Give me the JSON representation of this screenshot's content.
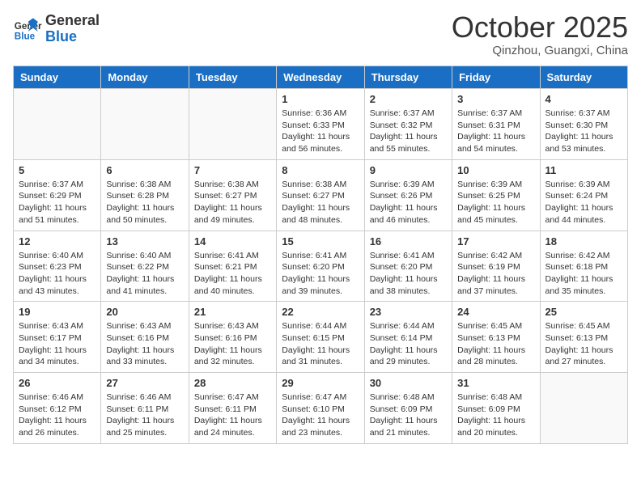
{
  "header": {
    "logo": {
      "general": "General",
      "blue": "Blue"
    },
    "title": "October 2025",
    "location": "Qinzhou, Guangxi, China"
  },
  "weekdays": [
    "Sunday",
    "Monday",
    "Tuesday",
    "Wednesday",
    "Thursday",
    "Friday",
    "Saturday"
  ],
  "weeks": [
    [
      {
        "day": "",
        "info": ""
      },
      {
        "day": "",
        "info": ""
      },
      {
        "day": "",
        "info": ""
      },
      {
        "day": "1",
        "info": "Sunrise: 6:36 AM\nSunset: 6:33 PM\nDaylight: 11 hours and 56 minutes."
      },
      {
        "day": "2",
        "info": "Sunrise: 6:37 AM\nSunset: 6:32 PM\nDaylight: 11 hours and 55 minutes."
      },
      {
        "day": "3",
        "info": "Sunrise: 6:37 AM\nSunset: 6:31 PM\nDaylight: 11 hours and 54 minutes."
      },
      {
        "day": "4",
        "info": "Sunrise: 6:37 AM\nSunset: 6:30 PM\nDaylight: 11 hours and 53 minutes."
      }
    ],
    [
      {
        "day": "5",
        "info": "Sunrise: 6:37 AM\nSunset: 6:29 PM\nDaylight: 11 hours and 51 minutes."
      },
      {
        "day": "6",
        "info": "Sunrise: 6:38 AM\nSunset: 6:28 PM\nDaylight: 11 hours and 50 minutes."
      },
      {
        "day": "7",
        "info": "Sunrise: 6:38 AM\nSunset: 6:27 PM\nDaylight: 11 hours and 49 minutes."
      },
      {
        "day": "8",
        "info": "Sunrise: 6:38 AM\nSunset: 6:27 PM\nDaylight: 11 hours and 48 minutes."
      },
      {
        "day": "9",
        "info": "Sunrise: 6:39 AM\nSunset: 6:26 PM\nDaylight: 11 hours and 46 minutes."
      },
      {
        "day": "10",
        "info": "Sunrise: 6:39 AM\nSunset: 6:25 PM\nDaylight: 11 hours and 45 minutes."
      },
      {
        "day": "11",
        "info": "Sunrise: 6:39 AM\nSunset: 6:24 PM\nDaylight: 11 hours and 44 minutes."
      }
    ],
    [
      {
        "day": "12",
        "info": "Sunrise: 6:40 AM\nSunset: 6:23 PM\nDaylight: 11 hours and 43 minutes."
      },
      {
        "day": "13",
        "info": "Sunrise: 6:40 AM\nSunset: 6:22 PM\nDaylight: 11 hours and 41 minutes."
      },
      {
        "day": "14",
        "info": "Sunrise: 6:41 AM\nSunset: 6:21 PM\nDaylight: 11 hours and 40 minutes."
      },
      {
        "day": "15",
        "info": "Sunrise: 6:41 AM\nSunset: 6:20 PM\nDaylight: 11 hours and 39 minutes."
      },
      {
        "day": "16",
        "info": "Sunrise: 6:41 AM\nSunset: 6:20 PM\nDaylight: 11 hours and 38 minutes."
      },
      {
        "day": "17",
        "info": "Sunrise: 6:42 AM\nSunset: 6:19 PM\nDaylight: 11 hours and 37 minutes."
      },
      {
        "day": "18",
        "info": "Sunrise: 6:42 AM\nSunset: 6:18 PM\nDaylight: 11 hours and 35 minutes."
      }
    ],
    [
      {
        "day": "19",
        "info": "Sunrise: 6:43 AM\nSunset: 6:17 PM\nDaylight: 11 hours and 34 minutes."
      },
      {
        "day": "20",
        "info": "Sunrise: 6:43 AM\nSunset: 6:16 PM\nDaylight: 11 hours and 33 minutes."
      },
      {
        "day": "21",
        "info": "Sunrise: 6:43 AM\nSunset: 6:16 PM\nDaylight: 11 hours and 32 minutes."
      },
      {
        "day": "22",
        "info": "Sunrise: 6:44 AM\nSunset: 6:15 PM\nDaylight: 11 hours and 31 minutes."
      },
      {
        "day": "23",
        "info": "Sunrise: 6:44 AM\nSunset: 6:14 PM\nDaylight: 11 hours and 29 minutes."
      },
      {
        "day": "24",
        "info": "Sunrise: 6:45 AM\nSunset: 6:13 PM\nDaylight: 11 hours and 28 minutes."
      },
      {
        "day": "25",
        "info": "Sunrise: 6:45 AM\nSunset: 6:13 PM\nDaylight: 11 hours and 27 minutes."
      }
    ],
    [
      {
        "day": "26",
        "info": "Sunrise: 6:46 AM\nSunset: 6:12 PM\nDaylight: 11 hours and 26 minutes."
      },
      {
        "day": "27",
        "info": "Sunrise: 6:46 AM\nSunset: 6:11 PM\nDaylight: 11 hours and 25 minutes."
      },
      {
        "day": "28",
        "info": "Sunrise: 6:47 AM\nSunset: 6:11 PM\nDaylight: 11 hours and 24 minutes."
      },
      {
        "day": "29",
        "info": "Sunrise: 6:47 AM\nSunset: 6:10 PM\nDaylight: 11 hours and 23 minutes."
      },
      {
        "day": "30",
        "info": "Sunrise: 6:48 AM\nSunset: 6:09 PM\nDaylight: 11 hours and 21 minutes."
      },
      {
        "day": "31",
        "info": "Sunrise: 6:48 AM\nSunset: 6:09 PM\nDaylight: 11 hours and 20 minutes."
      },
      {
        "day": "",
        "info": ""
      }
    ]
  ]
}
